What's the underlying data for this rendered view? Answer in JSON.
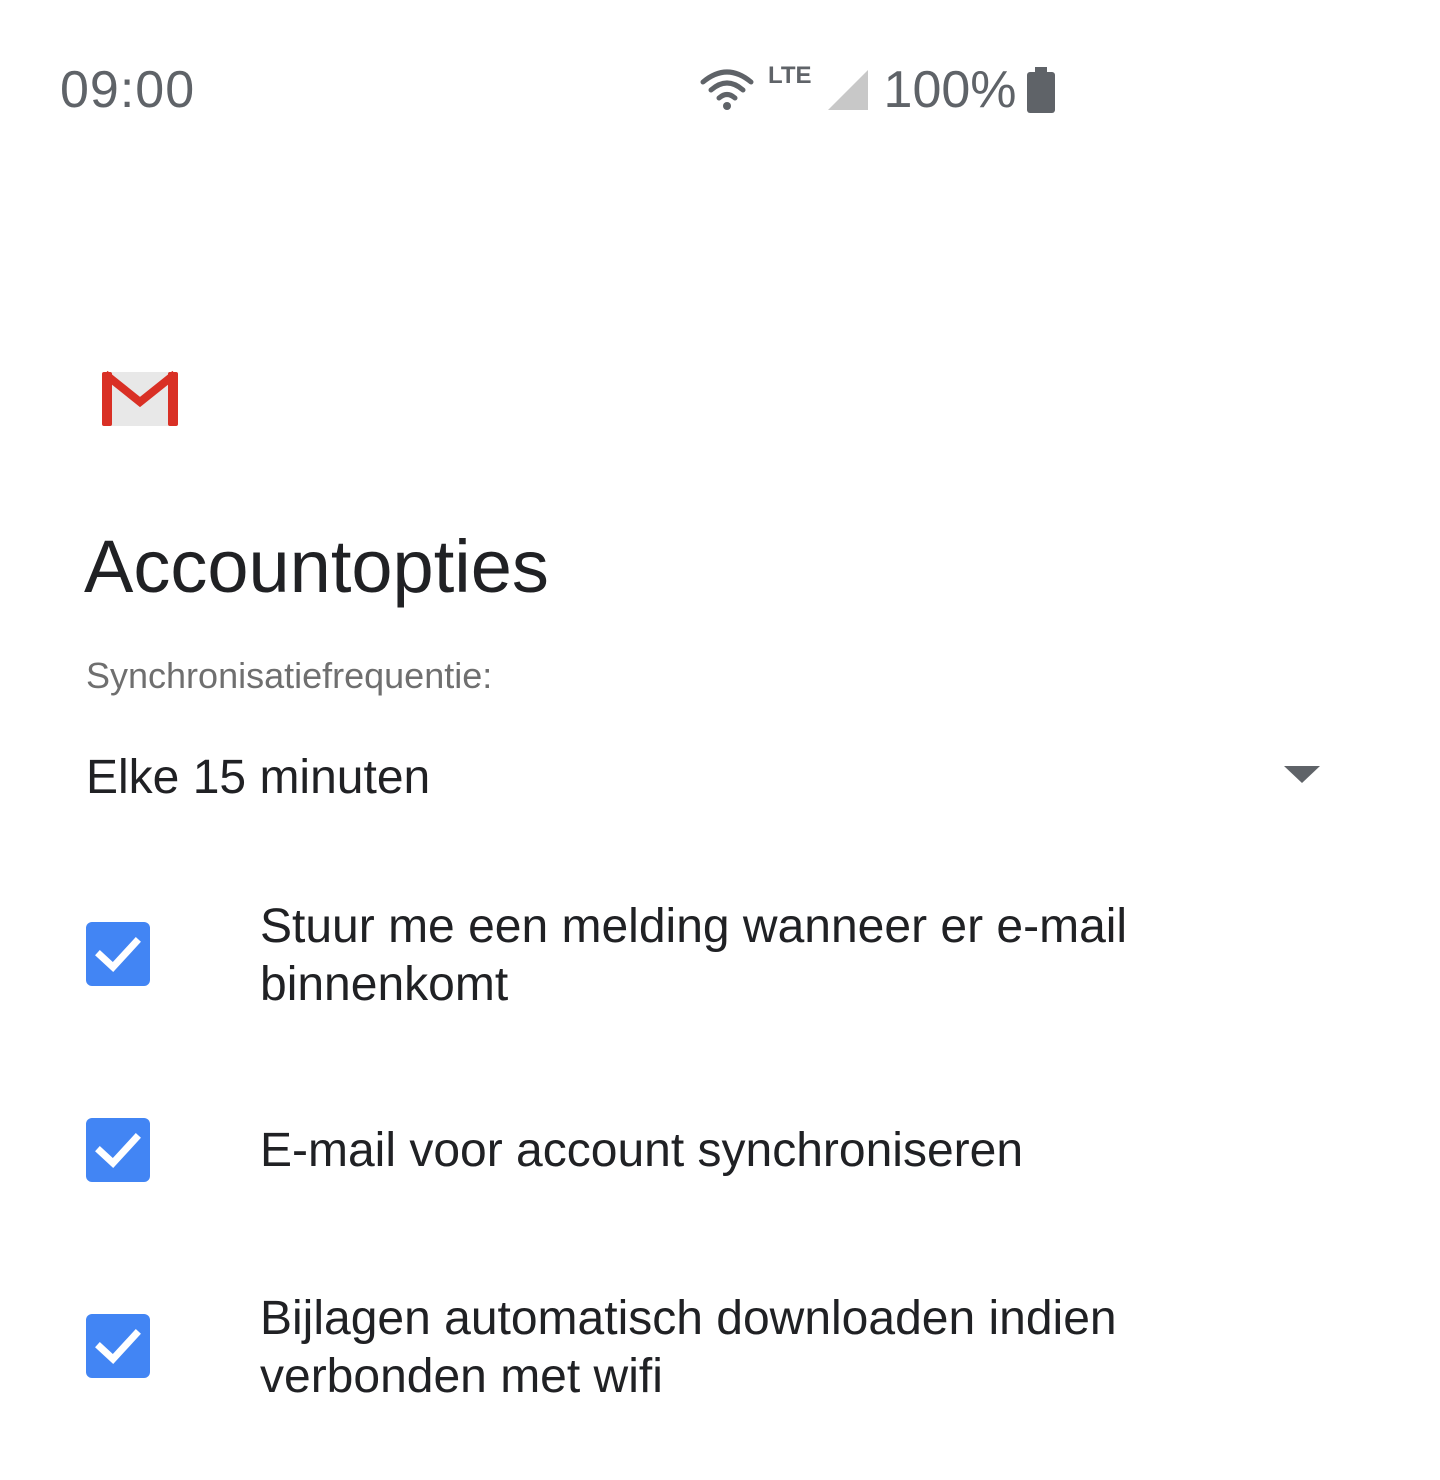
{
  "status_bar": {
    "time": "09:00",
    "network_label": "LTE",
    "battery_percent": "100%",
    "icons": [
      "wifi-icon",
      "signal-icon",
      "battery-icon"
    ]
  },
  "logo": {
    "icon": "gmail-icon"
  },
  "page": {
    "title": "Accountopties"
  },
  "sync": {
    "label": "Synchronisatiefrequentie:",
    "selected": "Elke 15 minuten"
  },
  "options": [
    {
      "label": "Stuur me een melding wanneer er e-mail binnenkomt",
      "checked": true
    },
    {
      "label": "E-mail voor account synchroniseren",
      "checked": true
    },
    {
      "label": "Bijlagen automatisch downloaden indien verbonden met wifi",
      "checked": true
    }
  ],
  "colors": {
    "accent": "#4285f4",
    "text_primary": "#202124",
    "text_secondary": "#6f6f6f",
    "gmail_red": "#d93025"
  }
}
